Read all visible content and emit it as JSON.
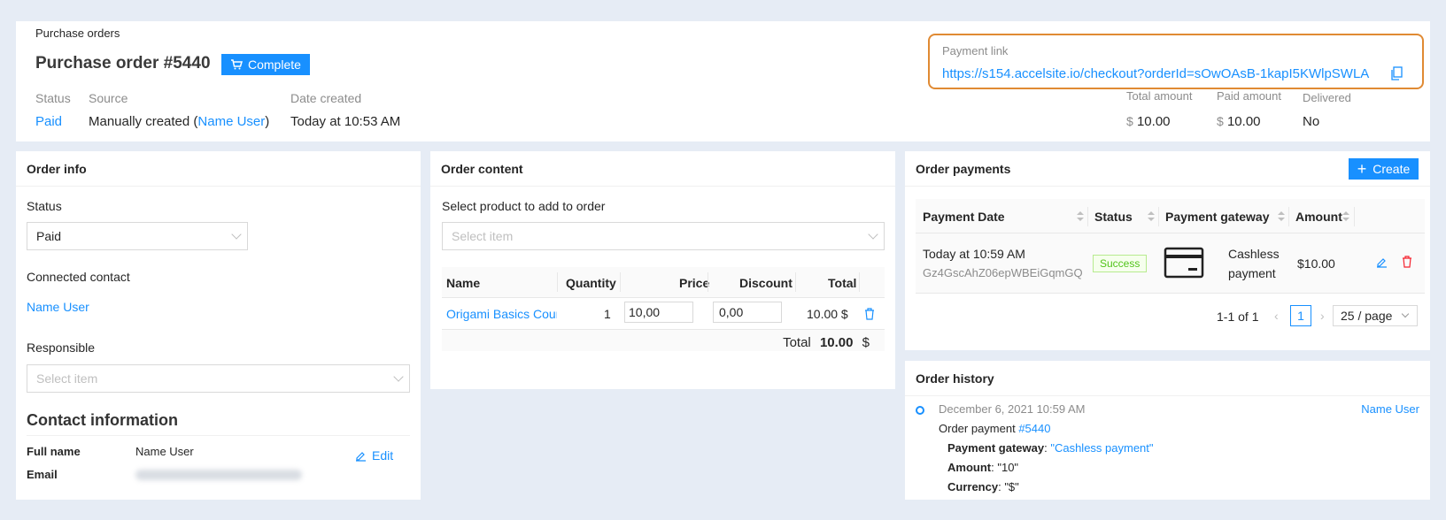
{
  "header": {
    "breadcrumb": "Purchase orders",
    "title": "Purchase order #5440",
    "status_badge": "Complete",
    "status_label": "Status",
    "status_value": "Paid",
    "source_label": "Source",
    "source_prefix": "Manually created (",
    "source_user": "Name User",
    "source_suffix": ")",
    "date_label": "Date created",
    "date_value": "Today at 10:53 AM",
    "payment_link_label": "Payment link",
    "payment_link_url": "https://s154.accelsite.io/checkout?orderId=sOwOAsB-1kapI5KWlpSWLA",
    "total_label": "Total amount",
    "total_currency": "$",
    "total_value": "10.00",
    "paid_label": "Paid amount",
    "paid_currency": "$",
    "paid_value": "10.00",
    "delivered_label": "Delivered",
    "delivered_value": "No"
  },
  "order_info": {
    "title": "Order info",
    "status_label": "Status",
    "status_value": "Paid",
    "contact_label": "Connected contact",
    "contact_value": "Name User",
    "responsible_label": "Responsible",
    "responsible_placeholder": "Select item",
    "contact_info_title": "Contact information",
    "full_name_label": "Full name",
    "full_name_value": "Name User",
    "edit_label": "Edit",
    "email_label": "Email"
  },
  "order_content": {
    "title": "Order content",
    "select_label": "Select product to add to order",
    "select_placeholder": "Select item",
    "columns": [
      "Name",
      "Quantity",
      "Price",
      "Discount",
      "Total"
    ],
    "row": {
      "name": "Origami Basics Cour",
      "quantity": "1",
      "price": "10,00",
      "discount": "0,00",
      "total": "10.00 $"
    },
    "total_label": "Total",
    "total_value": "10.00",
    "total_currency": "$"
  },
  "order_payments": {
    "title": "Order payments",
    "create_label": "Create",
    "columns": [
      "Payment Date",
      "Status",
      "Payment gateway",
      "Amount"
    ],
    "row": {
      "date": "Today at 10:59 AM",
      "payment_id": "Gz4GscAhZ06epWBEiGqmGQ",
      "status": "Success",
      "gateway_line1": "Cashless",
      "gateway_line2": "payment",
      "amount": "$10.00"
    },
    "pagination": {
      "range": "1-1 of 1",
      "page": "1",
      "page_size": "25 / page"
    }
  },
  "order_history": {
    "title": "Order history",
    "entry": {
      "datetime": "December 6, 2021 10:59 AM",
      "user": "Name User",
      "event_prefix": "Order payment ",
      "event_link": "#5440",
      "gateway_key": "Payment gateway",
      "gateway_value": "\"Cashless payment\"",
      "amount_key": "Amount",
      "amount_value": "\"10\"",
      "currency_key": "Currency",
      "currency_value": "\"$\""
    }
  },
  "colors": {
    "accent": "#1890ff",
    "highlight_border": "#e08a33",
    "success": "#52c41a",
    "danger": "#f5222d",
    "background": "#e6ecf5"
  }
}
